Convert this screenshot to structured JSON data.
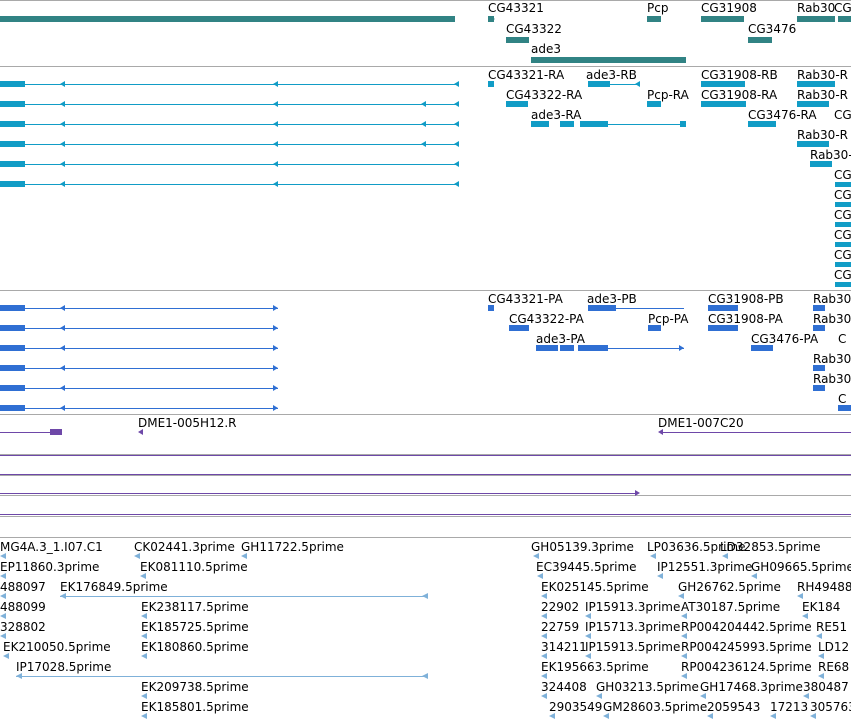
{
  "colors": {
    "background": "#ffffff",
    "divider": "#a9a9a9",
    "gene": "#318384",
    "transcript": "#119cc6",
    "protein": "#2f6fd3",
    "clone": "#6e48a8",
    "est": "#7fb1d9"
  },
  "tracks": {
    "genes": {
      "items": [
        {
          "label": "CG43321"
        },
        {
          "label": "Pcp"
        },
        {
          "label": "CG31908"
        },
        {
          "label": "Rab30"
        },
        {
          "label": "CG"
        },
        {
          "label": "CG43322"
        },
        {
          "label": "CG3476"
        },
        {
          "label": "ade3"
        }
      ]
    },
    "transcripts": {
      "items": [
        {
          "label": "CG43321-RA"
        },
        {
          "label": "ade3-RB"
        },
        {
          "label": "CG31908-RB"
        },
        {
          "label": "Rab30-R"
        },
        {
          "label": "CG43322-RA"
        },
        {
          "label": "Pcp-RA"
        },
        {
          "label": "CG31908-RA"
        },
        {
          "label": "Rab30-R"
        },
        {
          "label": "ade3-RA"
        },
        {
          "label": "CG3476-RA"
        },
        {
          "label": "CG"
        },
        {
          "label": "Rab30-R"
        },
        {
          "label": "Rab30-"
        },
        {
          "label": "CG"
        },
        {
          "label": "CG"
        },
        {
          "label": "CG"
        },
        {
          "label": "CG"
        },
        {
          "label": "CG"
        },
        {
          "label": "CG"
        }
      ]
    },
    "proteins": {
      "items": [
        {
          "label": "CG43321-PA"
        },
        {
          "label": "ade3-PB"
        },
        {
          "label": "CG31908-PB"
        },
        {
          "label": "Rab30"
        },
        {
          "label": "CG43322-PA"
        },
        {
          "label": "Pcp-PA"
        },
        {
          "label": "CG31908-PA"
        },
        {
          "label": "Rab30"
        },
        {
          "label": "ade3-PA"
        },
        {
          "label": "CG3476-PA"
        },
        {
          "label": "C"
        },
        {
          "label": "Rab30"
        },
        {
          "label": "Rab30"
        },
        {
          "label": "C"
        }
      ]
    },
    "clones": {
      "items": [
        {
          "label": "DME1-005H12.R"
        },
        {
          "label": "DME1-007C20"
        }
      ]
    },
    "ests": {
      "items": [
        {
          "label": "MG4A.3_1.I07.C1"
        },
        {
          "label": "CK02441.3prime"
        },
        {
          "label": "GH11722.5prime"
        },
        {
          "label": "GH05139.3prime"
        },
        {
          "label": "LP03636.5prime"
        },
        {
          "label": "LD32853.5prime"
        },
        {
          "label": "EP11860.3prime"
        },
        {
          "label": "EK081110.5prime"
        },
        {
          "label": "EC39445.5prime"
        },
        {
          "label": "IP12551.3prime"
        },
        {
          "label": "GH09665.5prime"
        },
        {
          "label": "488097"
        },
        {
          "label": "EK176849.5prime"
        },
        {
          "label": "EK025145.5prime"
        },
        {
          "label": "GH26762.5prime"
        },
        {
          "label": "RH49488"
        },
        {
          "label": "488099"
        },
        {
          "label": "EK238117.5prime"
        },
        {
          "label": "22902"
        },
        {
          "label": "IP15913.3prime"
        },
        {
          "label": "AT30187.5prime"
        },
        {
          "label": "EK184"
        },
        {
          "label": "328802"
        },
        {
          "label": "EK185725.5prime"
        },
        {
          "label": "22759"
        },
        {
          "label": "IP15713.3prime"
        },
        {
          "label": "RP004204442.5prime"
        },
        {
          "label": "RE51"
        },
        {
          "label": "EK210050.5prime"
        },
        {
          "label": "EK180860.5prime"
        },
        {
          "label": "314211"
        },
        {
          "label": "IP15913.5prime"
        },
        {
          "label": "RP004245993.5prime"
        },
        {
          "label": "LD12"
        },
        {
          "label": "IP17028.5prime"
        },
        {
          "label": "EK195663.5prime"
        },
        {
          "label": "RP004236124.5prime"
        },
        {
          "label": "RE68"
        },
        {
          "label": "EK209738.5prime"
        },
        {
          "label": "324408"
        },
        {
          "label": "GH03213.5prime"
        },
        {
          "label": "GH17468.3prime"
        },
        {
          "label": "380487"
        },
        {
          "label": "EK185801.5prime"
        },
        {
          "label": "2903549"
        },
        {
          "label": "GM28603.5prime"
        },
        {
          "label": "2059543"
        },
        {
          "label": "17213"
        },
        {
          "label": "305763"
        }
      ]
    }
  }
}
